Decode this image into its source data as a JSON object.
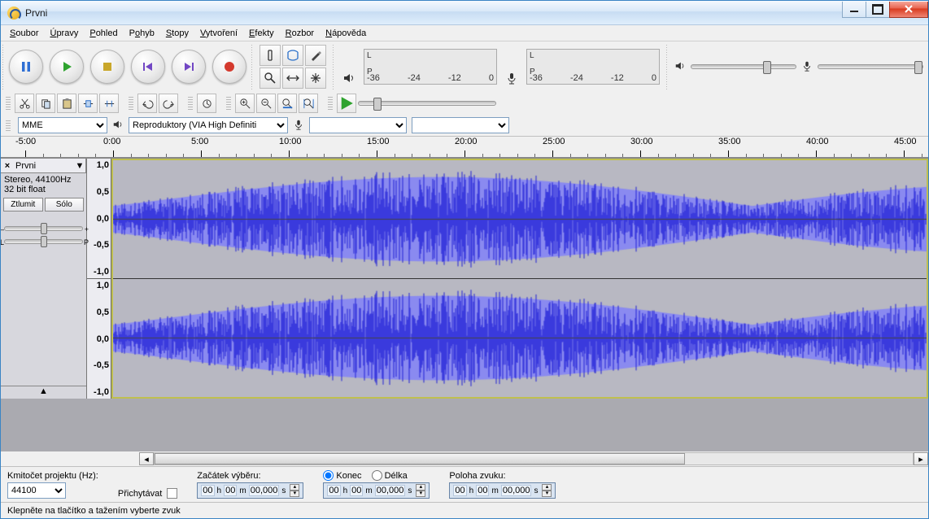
{
  "window": {
    "title": "Prvni"
  },
  "menu": {
    "items": [
      {
        "label": "Soubor",
        "accel": "S"
      },
      {
        "label": "Úpravy",
        "accel": "Ú"
      },
      {
        "label": "Pohled",
        "accel": "P"
      },
      {
        "label": "Pohyb",
        "accel": "o"
      },
      {
        "label": "Stopy",
        "accel": "S"
      },
      {
        "label": "Vytvoření",
        "accel": "V"
      },
      {
        "label": "Efekty",
        "accel": "E"
      },
      {
        "label": "Rozbor",
        "accel": "R"
      },
      {
        "label": "Nápověda",
        "accel": "N"
      }
    ]
  },
  "meter": {
    "left": "L",
    "right": "P",
    "scale": [
      "-36",
      "-24",
      "-12",
      "0"
    ]
  },
  "device": {
    "host": "MME",
    "output": "Reproduktory (VIA High Definiti",
    "input": ""
  },
  "ruler": {
    "labels": [
      "-5:00",
      "0:00",
      "5:00",
      "10:00",
      "15:00",
      "20:00",
      "25:00",
      "30:00",
      "35:00",
      "40:00",
      "45:00"
    ]
  },
  "track": {
    "name": "Prvni",
    "format_line1": "Stereo, 44100Hz",
    "format_line2": "32 bit float",
    "mute": "Ztlumit",
    "solo": "Sólo",
    "pan_left": "L",
    "pan_right": "P",
    "vscale": [
      "1,0",
      "0,5",
      "0,0",
      "-0,5",
      "-1,0"
    ]
  },
  "selectionbar": {
    "rate_label": "Kmitočet projektu (Hz):",
    "rate_value": "44100",
    "snap_label": "Přichytávat",
    "start_label": "Začátek výběru:",
    "end_label": "Konec",
    "length_label": "Délka",
    "position_label": "Poloha zvuku:",
    "time_units": {
      "h": "h",
      "m": "m",
      "s": "s"
    },
    "time_digits": {
      "h": "00",
      "m": "00",
      "s1": "00",
      "s2": "000"
    }
  },
  "status": {
    "text": "Klepněte na tlačítko a tažením vyberte zvuk"
  },
  "icons": {
    "pause": "pause",
    "play": "play",
    "stop": "stop",
    "skip_start": "skip-start",
    "skip_end": "skip-end",
    "record": "record",
    "selection": "ibeam",
    "envelope": "envelope",
    "draw": "pencil",
    "zoom": "zoom",
    "timeshift": "timeshift",
    "multi": "multi",
    "speaker": "speaker",
    "mic": "mic",
    "cut": "cut",
    "copy": "copy",
    "paste": "paste",
    "trim": "trim",
    "silence": "silence",
    "undo": "undo",
    "redo": "redo",
    "sync": "sync",
    "zoom_in": "zoom-in",
    "zoom_out": "zoom-out",
    "fit_sel": "fit-sel",
    "fit_proj": "fit-proj",
    "play_region": "play-region"
  }
}
